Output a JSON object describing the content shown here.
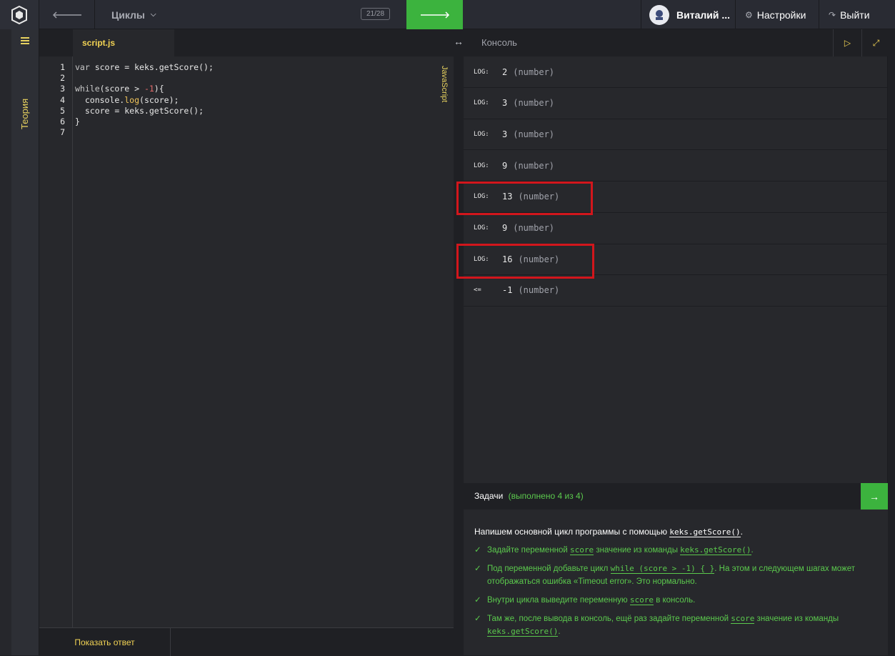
{
  "topbar": {
    "section": "Циклы",
    "progress": "21/28",
    "user_name": "Виталий ...",
    "settings": "Настройки",
    "logout": "Выйти"
  },
  "sidebar": {
    "theory": "Теория"
  },
  "editor": {
    "tab": "script.js",
    "language": "JavaScript",
    "line_numbers": [
      "1",
      "2",
      "3",
      "4",
      "5",
      "6",
      "7"
    ],
    "code_lines": [
      "var score = keks.getScore();",
      "",
      "while(score > -1){",
      "  console.log(score);",
      "  score = keks.getScore();",
      "}",
      ""
    ],
    "show_answer": "Показать ответ"
  },
  "console": {
    "title": "Консоль",
    "rows": [
      {
        "tag": "LOG:",
        "value": "2",
        "type": "(number)"
      },
      {
        "tag": "LOG:",
        "value": "3",
        "type": "(number)"
      },
      {
        "tag": "LOG:",
        "value": "3",
        "type": "(number)"
      },
      {
        "tag": "LOG:",
        "value": "9",
        "type": "(number)"
      },
      {
        "tag": "LOG:",
        "value": "13",
        "type": "(number)"
      },
      {
        "tag": "LOG:",
        "value": "9",
        "type": "(number)"
      },
      {
        "tag": "LOG:",
        "value": "16",
        "type": "(number)"
      },
      {
        "tag": "<=",
        "value": "-1",
        "type": "(number)"
      }
    ],
    "highlight_color": "#d2161c"
  },
  "tasks": {
    "title": "Задачи",
    "status": "(выполнено 4 из 4)",
    "intro_text": "Напишем основной цикл программы с помощью ",
    "intro_code": "keks.getScore()",
    "intro_end": ".",
    "items": [
      {
        "before": "Задайте переменной ",
        "code": "score",
        "middle": " значение из команды ",
        "code2": "keks.getScore()",
        "after": "."
      },
      {
        "before": "Под переменной добавьте цикл ",
        "code": "while (score > -1) { }",
        "middle": ". На этом и следующем шагах может отображаться ошибка «Timeout error». Это нормально.",
        "code2": "",
        "after": ""
      },
      {
        "before": "Внутри цикла выведите переменную ",
        "code": "score",
        "middle": " в консоль.",
        "code2": "",
        "after": ""
      },
      {
        "before": "Там же, после вывода в консоль, ещё раз задайте переменной ",
        "code": "score",
        "middle": " значение из команды ",
        "code2": "keks.getScore()",
        "after": "."
      }
    ]
  },
  "colors": {
    "accent_green": "#3cb33e",
    "accent_yellow": "#f2d354",
    "background": "#27282c"
  }
}
